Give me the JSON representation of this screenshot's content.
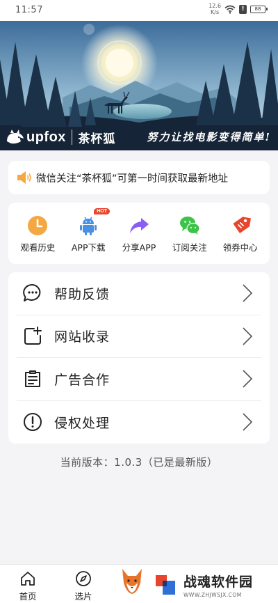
{
  "status_bar": {
    "time": "11:57",
    "net_speed_value": "12.6",
    "net_speed_unit": "K/s",
    "battery": "88"
  },
  "banner": {
    "logo_text": "upfox",
    "logo_cn": "茶杯狐",
    "slogan": "努力让找电影变得简单!"
  },
  "notice": {
    "icon": "speaker-icon",
    "text": "微信关注“茶杯狐”可第一时间获取最新地址"
  },
  "quick_actions": [
    {
      "label": "观看历史",
      "icon": "clock-icon",
      "color": "#f5a742"
    },
    {
      "label": "APP下载",
      "icon": "android-icon",
      "color": "#4a90e2",
      "badge": "HOT"
    },
    {
      "label": "分享APP",
      "icon": "share-arrow-icon",
      "color": "#8b5cf6"
    },
    {
      "label": "订阅关注",
      "icon": "wechat-icon",
      "color": "#3cc34a"
    },
    {
      "label": "领券中心",
      "icon": "coupon-tag-icon",
      "color": "#e8452c"
    }
  ],
  "menu": [
    {
      "label": "帮助反馈",
      "icon": "chat-bubble-icon"
    },
    {
      "label": "网站收录",
      "icon": "add-page-icon"
    },
    {
      "label": "广告合作",
      "icon": "document-icon"
    },
    {
      "label": "侵权处理",
      "icon": "alert-circle-icon"
    }
  ],
  "version_text": "当前版本：1.0.3（已是最新版）",
  "bottom_nav": [
    {
      "label": "首页",
      "icon": "home-icon"
    },
    {
      "label": "选片",
      "icon": "compass-icon"
    }
  ],
  "watermark": {
    "cn": "战魂软件园",
    "url": "WWW.ZHJWSJX.COM"
  }
}
